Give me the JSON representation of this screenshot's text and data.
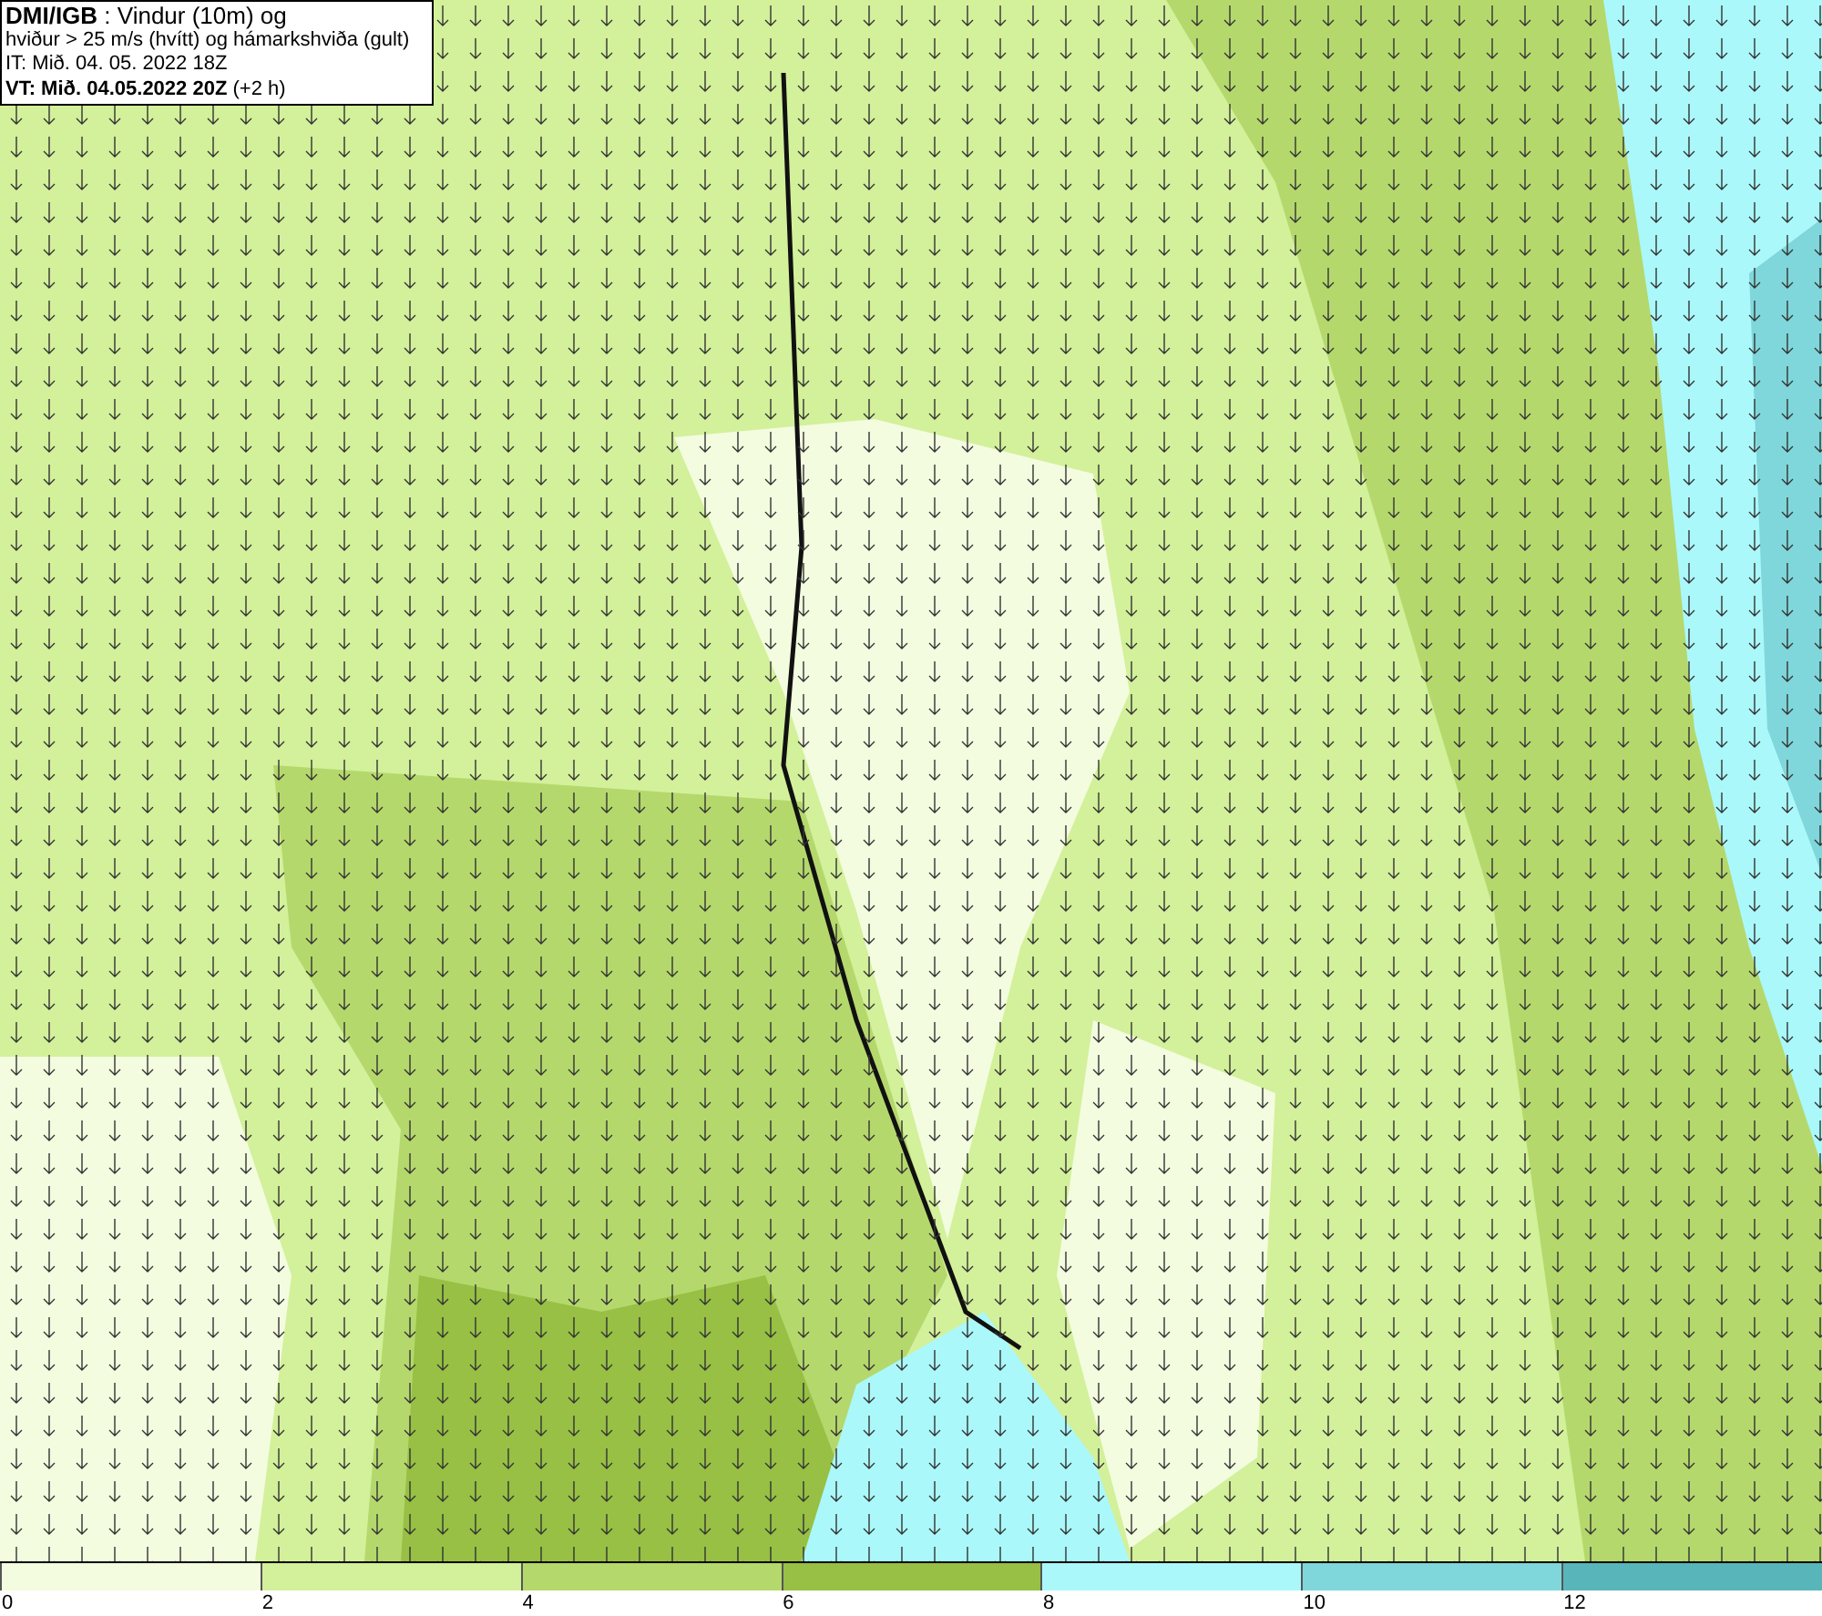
{
  "info_box": {
    "lines": [
      "**DMI/IGB** : Vindur (10m) og",
      "hviður > 25 m/s (hvítt) og hámarkshviða (gult)",
      "IT: Mið. 04. 05. 2022 18Z",
      "**VT: Mið. 04.05.2022 20Z** (+2 h)"
    ]
  },
  "legend": [
    {
      "label": "0",
      "color": "#f3fcdf"
    },
    {
      "label": "2",
      "color": "#d3f09a"
    },
    {
      "label": "4",
      "color": "#b5d86c"
    },
    {
      "label": "6",
      "color": "#97c044"
    },
    {
      "label": "8",
      "color": "#abf8fb"
    },
    {
      "label": "10",
      "color": "#80d7db"
    },
    {
      "label": "12",
      "color": "#58b6ba"
    }
  ]
}
